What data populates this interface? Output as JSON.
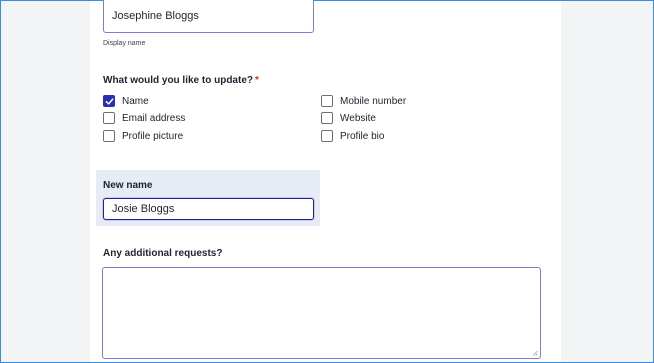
{
  "display_name": {
    "value": "Josephine Bloggs",
    "hint": "Display name"
  },
  "update_question": {
    "label": "What would you like to update?",
    "required_marker": "*",
    "options": [
      {
        "label": "Name",
        "checked": true
      },
      {
        "label": "Email address",
        "checked": false
      },
      {
        "label": "Profile picture",
        "checked": false
      },
      {
        "label": "Mobile number",
        "checked": false
      },
      {
        "label": "Website",
        "checked": false
      },
      {
        "label": "Profile bio",
        "checked": false
      }
    ]
  },
  "new_name": {
    "label": "New name",
    "value": "Josie Bloggs"
  },
  "additional_requests": {
    "label": "Any additional requests?",
    "value": ""
  },
  "colors": {
    "accent": "#2b2fb3",
    "focus_border": "#1e229a",
    "required": "#d4351c",
    "conditional_bg": "#e6ebf5",
    "page_bg": "#f3f4f6",
    "frame_border": "#3a8ce0"
  },
  "icons": {
    "checkmark": "check-icon",
    "resize": "resize-grip-icon"
  }
}
